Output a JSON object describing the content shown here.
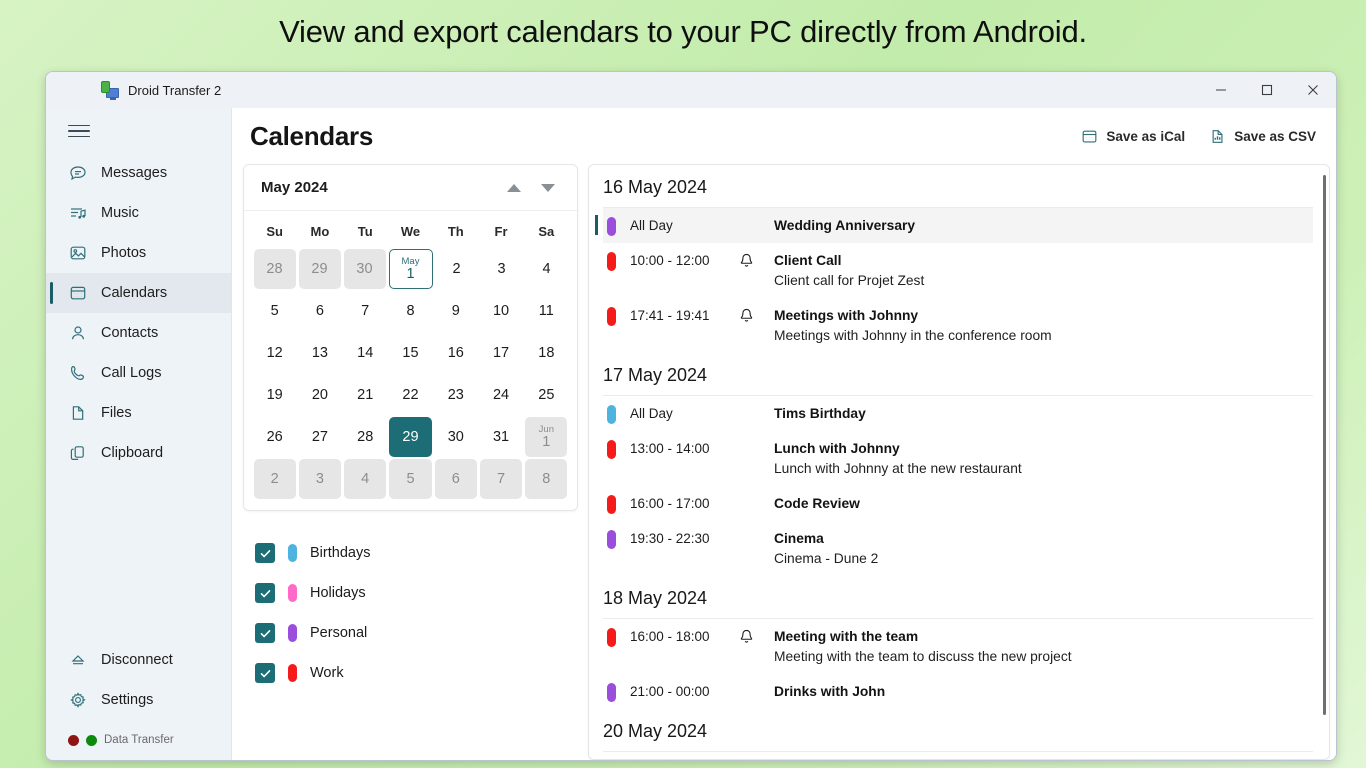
{
  "headline": "View and export calendars to your PC directly from Android.",
  "window": {
    "app_icon": "android-to-pc-icon",
    "title": "Droid Transfer 2",
    "minimize_label": "Minimize",
    "maximize_label": "Maximize",
    "close_label": "Close"
  },
  "sidebar": {
    "menu_icon": "hamburger-icon",
    "items": [
      {
        "label": "Messages",
        "icon": "message-icon",
        "selected": false
      },
      {
        "label": "Music",
        "icon": "music-icon",
        "selected": false
      },
      {
        "label": "Photos",
        "icon": "photo-icon",
        "selected": false
      },
      {
        "label": "Calendars",
        "icon": "calendar-icon",
        "selected": true
      },
      {
        "label": "Contacts",
        "icon": "person-icon",
        "selected": false
      },
      {
        "label": "Call Logs",
        "icon": "phone-icon",
        "selected": false
      },
      {
        "label": "Files",
        "icon": "file-icon",
        "selected": false
      },
      {
        "label": "Clipboard",
        "icon": "clipboard-icon",
        "selected": false
      }
    ],
    "bottom_items": [
      {
        "label": "Disconnect",
        "icon": "eject-icon"
      },
      {
        "label": "Settings",
        "icon": "gear-icon"
      }
    ],
    "status": {
      "text": "Data Transfer",
      "dot_red": "#8f1414",
      "dot_green": "#0d8a0d"
    }
  },
  "header": {
    "title": "Calendars",
    "actions": [
      {
        "label": "Save as iCal",
        "icon": "calendar-export-icon"
      },
      {
        "label": "Save as CSV",
        "icon": "chart-file-icon"
      }
    ]
  },
  "calendar_widget": {
    "month_label": "May 2024",
    "prev_icon": "triangle-up-icon",
    "next_icon": "triangle-down-icon",
    "weekdays": [
      "Su",
      "Mo",
      "Tu",
      "We",
      "Th",
      "Fr",
      "Sa"
    ],
    "weeks": [
      [
        {
          "day": "28",
          "state": "other"
        },
        {
          "day": "29",
          "state": "other"
        },
        {
          "day": "30",
          "state": "other"
        },
        {
          "day": "1",
          "month_label": "May",
          "state": "today"
        },
        {
          "day": "2",
          "state": "normal"
        },
        {
          "day": "3",
          "state": "normal"
        },
        {
          "day": "4",
          "state": "normal"
        }
      ],
      [
        {
          "day": "5",
          "state": "normal"
        },
        {
          "day": "6",
          "state": "normal"
        },
        {
          "day": "7",
          "state": "normal"
        },
        {
          "day": "8",
          "state": "normal"
        },
        {
          "day": "9",
          "state": "normal"
        },
        {
          "day": "10",
          "state": "normal"
        },
        {
          "day": "11",
          "state": "normal"
        }
      ],
      [
        {
          "day": "12",
          "state": "normal"
        },
        {
          "day": "13",
          "state": "normal"
        },
        {
          "day": "14",
          "state": "normal"
        },
        {
          "day": "15",
          "state": "normal"
        },
        {
          "day": "16",
          "state": "normal"
        },
        {
          "day": "17",
          "state": "normal"
        },
        {
          "day": "18",
          "state": "normal"
        }
      ],
      [
        {
          "day": "19",
          "state": "normal"
        },
        {
          "day": "20",
          "state": "normal"
        },
        {
          "day": "21",
          "state": "normal"
        },
        {
          "day": "22",
          "state": "normal"
        },
        {
          "day": "23",
          "state": "normal"
        },
        {
          "day": "24",
          "state": "normal"
        },
        {
          "day": "25",
          "state": "normal"
        }
      ],
      [
        {
          "day": "26",
          "state": "normal"
        },
        {
          "day": "27",
          "state": "normal"
        },
        {
          "day": "28",
          "state": "normal"
        },
        {
          "day": "29",
          "state": "selected"
        },
        {
          "day": "30",
          "state": "normal"
        },
        {
          "day": "31",
          "state": "normal"
        },
        {
          "day": "1",
          "month_label": "Jun",
          "state": "other"
        }
      ],
      [
        {
          "day": "2",
          "state": "other"
        },
        {
          "day": "3",
          "state": "other"
        },
        {
          "day": "4",
          "state": "other"
        },
        {
          "day": "5",
          "state": "other"
        },
        {
          "day": "6",
          "state": "other"
        },
        {
          "day": "7",
          "state": "other"
        },
        {
          "day": "8",
          "state": "other"
        }
      ]
    ]
  },
  "calendar_filters": [
    {
      "label": "Birthdays",
      "color": "#4fb3e0",
      "checked": true
    },
    {
      "label": "Holidays",
      "color": "#ff69c8",
      "checked": true
    },
    {
      "label": "Personal",
      "color": "#9b4ddb",
      "checked": true
    },
    {
      "label": "Work",
      "color": "#f51b1b",
      "checked": true
    }
  ],
  "events": [
    {
      "date": "16 May 2024",
      "items": [
        {
          "time": "All Day",
          "title": "Wedding Anniversary",
          "desc": "",
          "color": "#9b4ddb",
          "alarm": false,
          "selected": true
        },
        {
          "time": "10:00 - 12:00",
          "title": "Client Call",
          "desc": "Client call for Projet Zest",
          "color": "#f51b1b",
          "alarm": true,
          "selected": false
        },
        {
          "time": "17:41 - 19:41",
          "title": "Meetings with Johnny",
          "desc": "Meetings with Johnny in the conference room",
          "color": "#f51b1b",
          "alarm": true,
          "selected": false
        }
      ]
    },
    {
      "date": "17 May 2024",
      "items": [
        {
          "time": "All Day",
          "title": "Tims Birthday",
          "desc": "",
          "color": "#4fb3e0",
          "alarm": false,
          "selected": false
        },
        {
          "time": "13:00 - 14:00",
          "title": "Lunch with Johnny",
          "desc": "Lunch with Johnny at the new restaurant",
          "color": "#f51b1b",
          "alarm": false,
          "selected": false
        },
        {
          "time": "16:00 - 17:00",
          "title": "Code Review",
          "desc": "",
          "color": "#f51b1b",
          "alarm": false,
          "selected": false
        },
        {
          "time": "19:30 - 22:30",
          "title": "Cinema",
          "desc": "Cinema - Dune 2",
          "color": "#9b4ddb",
          "alarm": false,
          "selected": false
        }
      ]
    },
    {
      "date": "18 May 2024",
      "items": [
        {
          "time": "16:00 - 18:00",
          "title": "Meeting with the team",
          "desc": "Meeting with the team to discuss the new project",
          "color": "#f51b1b",
          "alarm": true,
          "selected": false
        },
        {
          "time": "21:00 - 00:00",
          "title": "Drinks with John",
          "desc": "",
          "color": "#9b4ddb",
          "alarm": false,
          "selected": false
        }
      ]
    },
    {
      "date": "20 May 2024",
      "items": []
    }
  ]
}
